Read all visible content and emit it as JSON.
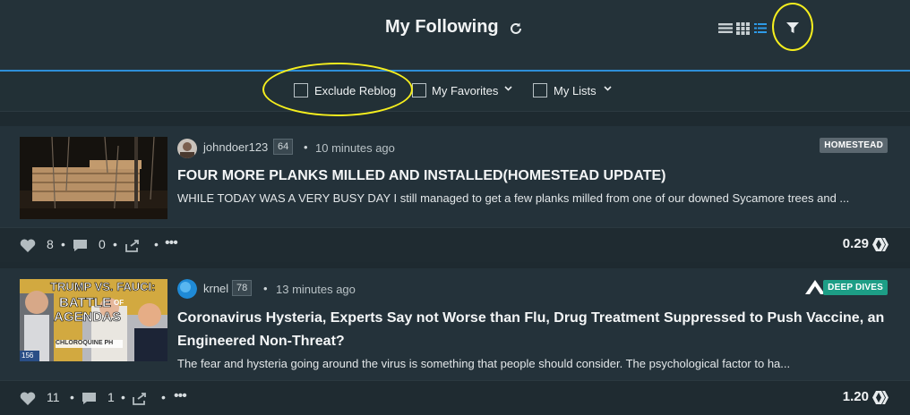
{
  "header": {
    "title": "My Following",
    "icons": [
      "refresh-icon",
      "view-list-icon",
      "view-grid-icon",
      "view-compact-icon",
      "filter-icon"
    ],
    "accent": "#2e8fd8",
    "highlight": "#f5ee1e"
  },
  "filters": {
    "exclude_reblog": "Exclude Reblog",
    "my_favorites": "My Favorites",
    "my_lists": "My Lists"
  },
  "posts": [
    {
      "author": "johndoer123",
      "reputation": "64",
      "time": "10 minutes ago",
      "tag": "HOMESTEAD",
      "title": "FOUR MORE PLANKS MILLED AND INSTALLED(HOMESTEAD UPDATE)",
      "excerpt": "WHILE TODAY WAS A VERY BUSY DAY I still managed to get a few planks milled from one of our downed Sycamore trees and ...",
      "votes": "8",
      "comments": "0",
      "payout": "0.29"
    },
    {
      "author": "krnel",
      "reputation": "78",
      "time": "13 minutes ago",
      "tag": "DEEP DIVES",
      "title": "Coronavirus Hysteria, Experts Say not Worse than Flu, Drug Treatment Suppressed to Push Vaccine, an Engineered Non-Threat?",
      "excerpt": "The fear and hysteria going around the virus is something that people should consider. The psychological factor to ha...",
      "thumb_text_1": "TRUMP VS. FAUCI:",
      "thumb_text_2": "BATTLE",
      "thumb_text_3": "OF",
      "thumb_text_4": "AGENDAS",
      "thumb_text_5": "CHLOROQUINE PH",
      "thumb_text_6": "156",
      "votes": "11",
      "comments": "1",
      "payout": "1.20"
    }
  ]
}
